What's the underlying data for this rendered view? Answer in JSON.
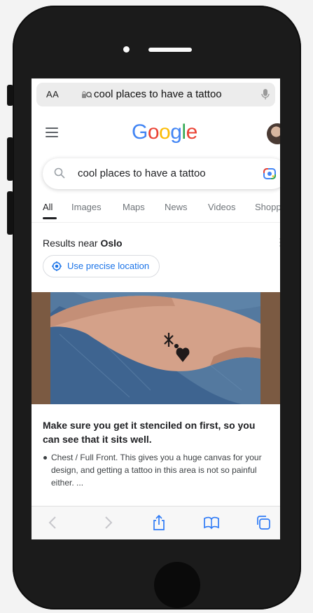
{
  "browser": {
    "text_size_label": "AA",
    "url_query": "cool places to have a tattoo"
  },
  "google": {
    "logo_letters": [
      "G",
      "o",
      "o",
      "g",
      "l",
      "e"
    ],
    "logo_colors": [
      "#4285F4",
      "#EA4335",
      "#FBBC05",
      "#4285F4",
      "#34A853",
      "#EA4335"
    ],
    "search_value": "cool places to have a tattoo",
    "tabs": [
      "All",
      "Images",
      "Maps",
      "News",
      "Videos",
      "Shoppin"
    ],
    "active_tab": "All",
    "results_near_prefix": "Results near",
    "results_near_city": "Oslo",
    "precise_location_label": "Use precise location",
    "snippet_title": "Make sure you get it stenciled on first, so you can see that it sits well.",
    "bullet": "Chest / Full Front. This gives you a huge canvas for your design, and getting a tattoo in this area is not so painful either. ..."
  },
  "toolbar_icons": [
    "back-icon",
    "forward-icon",
    "share-icon",
    "bookmarks-icon",
    "tabs-icon"
  ],
  "colors": {
    "link_blue": "#1a73e8",
    "toolbar_blue": "#2f7bf6"
  }
}
